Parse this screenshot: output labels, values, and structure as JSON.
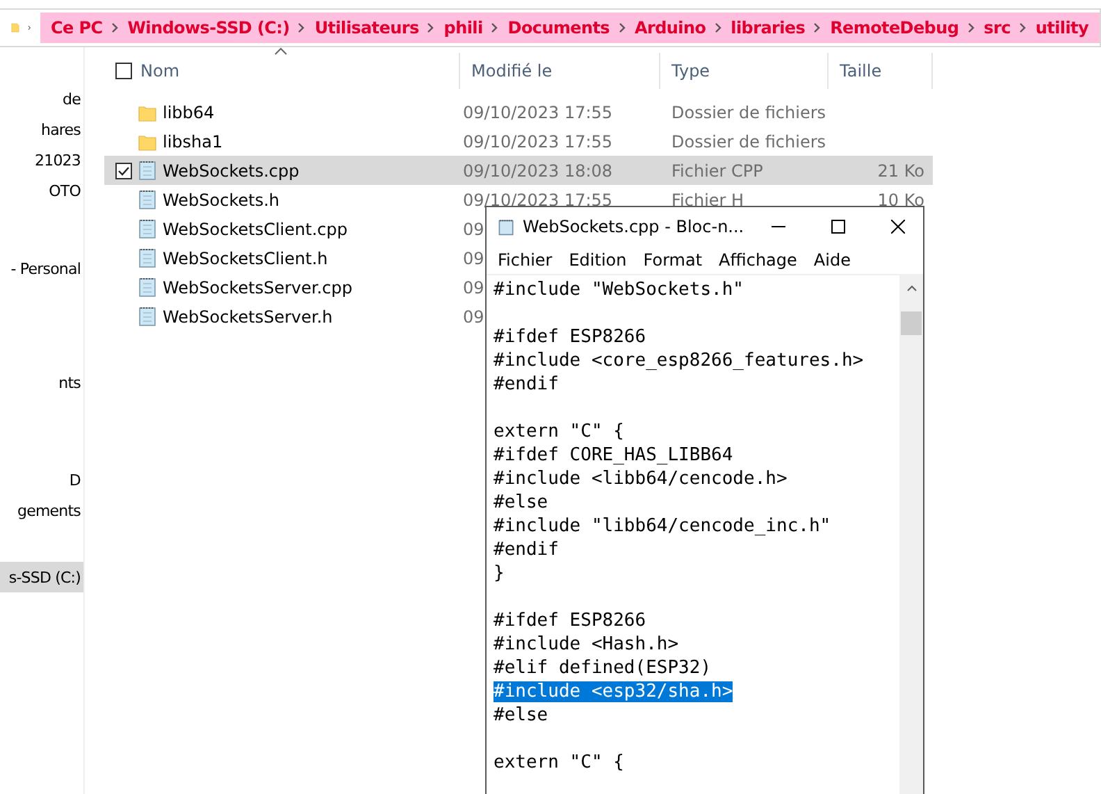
{
  "breadcrumb": [
    "Ce PC",
    "Windows-SSD (C:)",
    "Utilisateurs",
    "phili",
    "Documents",
    "Arduino",
    "libraries",
    "RemoteDebug",
    "src",
    "utility"
  ],
  "sidebar": {
    "items": [
      {
        "label": "de",
        "selected": false
      },
      {
        "label": "hares",
        "selected": false
      },
      {
        "label": "21023",
        "selected": false
      },
      {
        "label": "OTO",
        "selected": false
      },
      {
        "label": "- Personal",
        "selected": false
      },
      {
        "label": "nts",
        "selected": false
      },
      {
        "label": "D",
        "selected": false
      },
      {
        "label": "gements",
        "selected": false
      },
      {
        "label": "s-SSD (C:)",
        "selected": true
      }
    ]
  },
  "table": {
    "select_all": {
      "checked": false
    },
    "columns": [
      "Nom",
      "Modifié le",
      "Type",
      "Taille"
    ],
    "rows": [
      {
        "kind": "folder",
        "name": "libb64",
        "date": "09/10/2023 17:55",
        "type": "Dossier de fichiers",
        "size": "",
        "selected": false
      },
      {
        "kind": "folder",
        "name": "libsha1",
        "date": "09/10/2023 17:55",
        "type": "Dossier de fichiers",
        "size": "",
        "selected": false
      },
      {
        "kind": "file",
        "name": "WebSockets.cpp",
        "date": "09/10/2023 18:08",
        "type": "Fichier CPP",
        "size": "21 Ko",
        "selected": true
      },
      {
        "kind": "file",
        "name": "WebSockets.h",
        "date": "09/10/2023 17:55",
        "type": "Fichier H",
        "size": "10 Ko",
        "selected": false
      },
      {
        "kind": "file",
        "name": "WebSocketsClient.cpp",
        "date": "09",
        "type": "",
        "size": "",
        "selected": false
      },
      {
        "kind": "file",
        "name": "WebSocketsClient.h",
        "date": "09",
        "type": "",
        "size": "",
        "selected": false
      },
      {
        "kind": "file",
        "name": "WebSocketsServer.cpp",
        "date": "09",
        "type": "",
        "size": "",
        "selected": false
      },
      {
        "kind": "file",
        "name": "WebSocketsServer.h",
        "date": "09",
        "type": "",
        "size": "",
        "selected": false
      }
    ]
  },
  "notepad": {
    "title": "WebSockets.cpp - Bloc-n...",
    "menu": [
      "Fichier",
      "Edition",
      "Format",
      "Affichage",
      "Aide"
    ],
    "lines": [
      {
        "kind": "text",
        "text": "#include \"WebSockets.h\"",
        "selected": false
      },
      {
        "kind": "blank"
      },
      {
        "kind": "text",
        "text": "#ifdef ESP8266",
        "selected": false
      },
      {
        "kind": "text",
        "text": "#include <core_esp8266_features.h>",
        "selected": false
      },
      {
        "kind": "text",
        "text": "#endif",
        "selected": false
      },
      {
        "kind": "blank"
      },
      {
        "kind": "text",
        "text": "extern \"C\" {",
        "selected": false
      },
      {
        "kind": "text",
        "text": "#ifdef CORE_HAS_LIBB64",
        "selected": false
      },
      {
        "kind": "text",
        "text": "#include <libb64/cencode.h>",
        "selected": false
      },
      {
        "kind": "text",
        "text": "#else",
        "selected": false
      },
      {
        "kind": "text",
        "text": "#include \"libb64/cencode_inc.h\"",
        "selected": false
      },
      {
        "kind": "text",
        "text": "#endif",
        "selected": false
      },
      {
        "kind": "text",
        "text": "}",
        "selected": false
      },
      {
        "kind": "blank"
      },
      {
        "kind": "text",
        "text": "#ifdef ESP8266",
        "selected": false
      },
      {
        "kind": "text",
        "text": "#include <Hash.h>",
        "selected": false
      },
      {
        "kind": "text",
        "text": "#elif defined(ESP32)",
        "selected": false
      },
      {
        "kind": "text",
        "text": "#include <esp32/sha.h>",
        "selected": true
      },
      {
        "kind": "text",
        "text": "#else",
        "selected": false
      },
      {
        "kind": "blank"
      },
      {
        "kind": "text",
        "text": "extern \"C\" {",
        "selected": false
      }
    ]
  }
}
